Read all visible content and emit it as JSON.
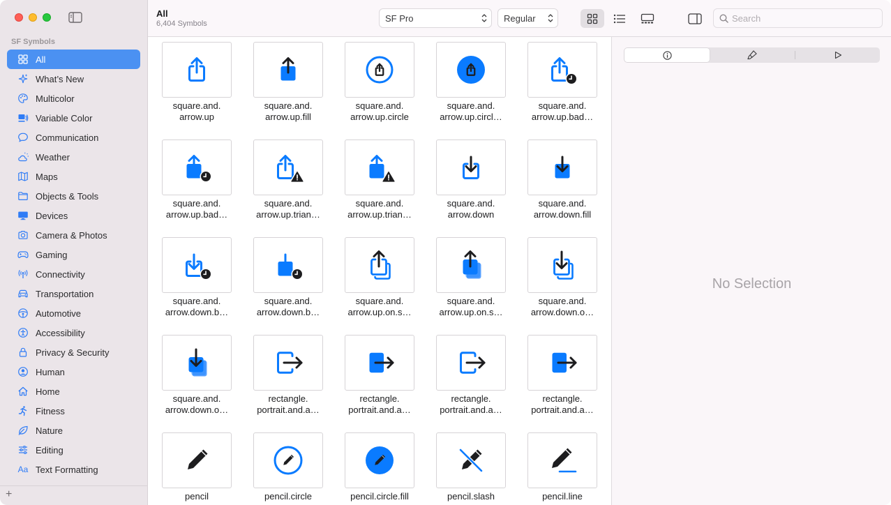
{
  "sidebar": {
    "section_title": "SF Symbols",
    "items": [
      {
        "label": "All",
        "icon": "grid-icon",
        "active": true
      },
      {
        "label": "What’s New",
        "icon": "sparkles-icon"
      },
      {
        "label": "Multicolor",
        "icon": "paintpalette-icon"
      },
      {
        "label": "Variable Color",
        "icon": "variable-color-icon"
      },
      {
        "label": "Communication",
        "icon": "message-bubble-icon"
      },
      {
        "label": "Weather",
        "icon": "cloud-sun-icon"
      },
      {
        "label": "Maps",
        "icon": "map-icon"
      },
      {
        "label": "Objects & Tools",
        "icon": "folder-icon"
      },
      {
        "label": "Devices",
        "icon": "display-icon"
      },
      {
        "label": "Camera & Photos",
        "icon": "camera-icon"
      },
      {
        "label": "Gaming",
        "icon": "gamecontroller-icon"
      },
      {
        "label": "Connectivity",
        "icon": "antenna-icon"
      },
      {
        "label": "Transportation",
        "icon": "car-icon"
      },
      {
        "label": "Automotive",
        "icon": "steering-wheel-icon"
      },
      {
        "label": "Accessibility",
        "icon": "accessibility-icon"
      },
      {
        "label": "Privacy & Security",
        "icon": "lock-icon"
      },
      {
        "label": "Human",
        "icon": "person-circle-icon"
      },
      {
        "label": "Home",
        "icon": "house-icon"
      },
      {
        "label": "Fitness",
        "icon": "figure-run-icon"
      },
      {
        "label": "Nature",
        "icon": "leaf-icon"
      },
      {
        "label": "Editing",
        "icon": "sliders-icon"
      },
      {
        "label": "Text Formatting",
        "icon": "textformat-icon"
      }
    ],
    "add_label": "+"
  },
  "toolbar": {
    "title": "All",
    "subtitle": "6,404 Symbols",
    "font_popup": "SF Pro",
    "weight_popup": "Regular",
    "search_placeholder": "Search"
  },
  "grid": {
    "symbols": [
      {
        "line1": "square.and.",
        "line2": "arrow.up",
        "icon": "square-arrow-up-icon"
      },
      {
        "line1": "square.and.",
        "line2": "arrow.up.fill",
        "icon": "square-arrow-up-fill-icon"
      },
      {
        "line1": "square.and.",
        "line2": "arrow.up.circle",
        "icon": "square-arrow-up-circle-icon"
      },
      {
        "line1": "square.and.",
        "line2": "arrow.up.circl…",
        "icon": "square-arrow-up-circle-fill-icon"
      },
      {
        "line1": "square.and.",
        "line2": "arrow.up.bad…",
        "icon": "square-arrow-up-badge-clock-icon"
      },
      {
        "line1": "square.and.",
        "line2": "arrow.up.bad…",
        "icon": "square-arrow-up-fill-badge-clock-icon"
      },
      {
        "line1": "square.and.",
        "line2": "arrow.up.trian…",
        "icon": "square-arrow-up-triangle-badge-icon"
      },
      {
        "line1": "square.and.",
        "line2": "arrow.up.trian…",
        "icon": "square-arrow-up-fill-triangle-badge-icon"
      },
      {
        "line1": "square.and.",
        "line2": "arrow.down",
        "icon": "square-arrow-down-icon"
      },
      {
        "line1": "square.and.",
        "line2": "arrow.down.fill",
        "icon": "square-arrow-down-fill-icon"
      },
      {
        "line1": "square.and.",
        "line2": "arrow.down.b…",
        "icon": "square-arrow-down-badge-clock-icon"
      },
      {
        "line1": "square.and.",
        "line2": "arrow.down.b…",
        "icon": "square-arrow-down-fill-badge-clock-icon"
      },
      {
        "line1": "square.and.",
        "line2": "arrow.up.on.s…",
        "icon": "square-arrow-up-on-square-icon"
      },
      {
        "line1": "square.and.",
        "line2": "arrow.up.on.s…",
        "icon": "square-arrow-up-on-square-fill-icon"
      },
      {
        "line1": "square.and.",
        "line2": "arrow.down.o…",
        "icon": "square-arrow-down-on-square-icon"
      },
      {
        "line1": "square.and.",
        "line2": "arrow.down.o…",
        "icon": "square-arrow-down-on-square-fill-icon"
      },
      {
        "line1": "rectangle.",
        "line2": "portrait.and.a…",
        "icon": "rectangle-portrait-arrow-right-icon"
      },
      {
        "line1": "rectangle.",
        "line2": "portrait.and.a…",
        "icon": "rectangle-portrait-arrow-right-fill-icon"
      },
      {
        "line1": "rectangle.",
        "line2": "portrait.and.a…",
        "icon": "rectangle-portrait-arrow-right-icon"
      },
      {
        "line1": "rectangle.",
        "line2": "portrait.and.a…",
        "icon": "rectangle-portrait-arrow-right-fill-icon"
      },
      {
        "line1": "pencil",
        "line2": "",
        "icon": "pencil-icon"
      },
      {
        "line1": "pencil.circle",
        "line2": "",
        "icon": "pencil-circle-icon"
      },
      {
        "line1": "pencil.circle.fill",
        "line2": "",
        "icon": "pencil-circle-fill-icon"
      },
      {
        "line1": "pencil.slash",
        "line2": "",
        "icon": "pencil-slash-icon"
      },
      {
        "line1": "pencil.line",
        "line2": "",
        "icon": "pencil-line-icon"
      }
    ]
  },
  "inspector": {
    "tabs": [
      {
        "icon": "info-circle-icon",
        "selected": true
      },
      {
        "icon": "paintbrush-icon"
      },
      {
        "icon": "play-icon"
      }
    ],
    "empty_text": "No Selection"
  },
  "colors": {
    "accent": "#0a7bff",
    "sidebar_selection": "#4b91f2",
    "glyph_dark": "#1d1d1f"
  }
}
